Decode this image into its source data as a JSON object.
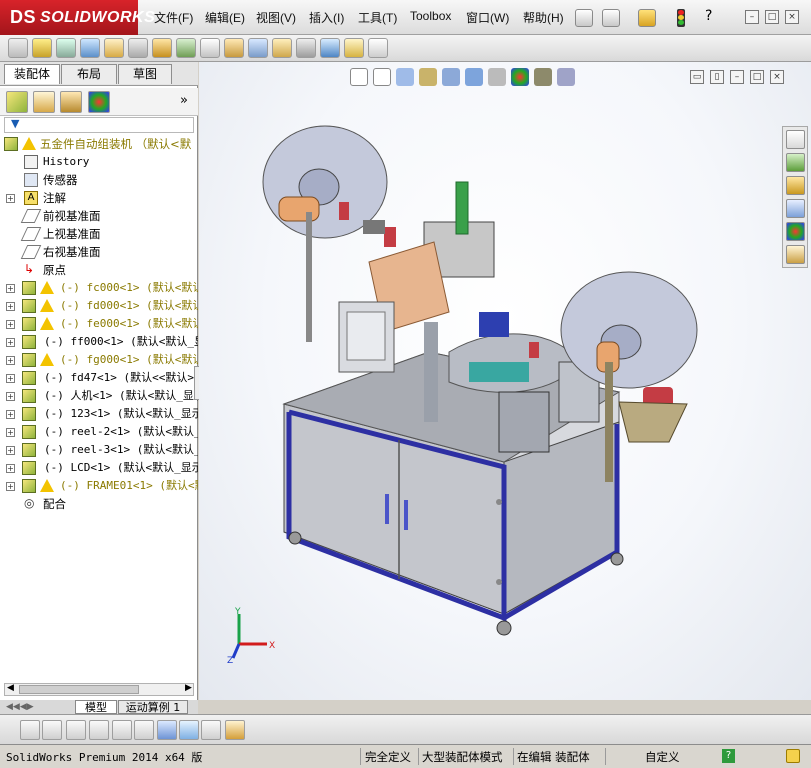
{
  "app": {
    "logo_text": "SOLIDWORKS",
    "logo_prefix": "DS"
  },
  "menu": {
    "items": [
      "文件(F)",
      "编辑(E)",
      "视图(V)",
      "插入(I)",
      "工具(T)",
      "Toolbox",
      "窗口(W)",
      "帮助(H)"
    ]
  },
  "tabs": {
    "items": [
      "装配体",
      "布局",
      "草图"
    ]
  },
  "tree": {
    "root": "五金件自动组装机 （默认<默",
    "items": [
      {
        "label": "History",
        "mono": true
      },
      {
        "label": "传感器"
      },
      {
        "label": "注解"
      },
      {
        "label": "前视基准面"
      },
      {
        "label": "上视基准面"
      },
      {
        "label": "右视基准面"
      },
      {
        "label": "原点"
      },
      {
        "label": "(-) fc000<1> (默认<默认",
        "warn": true
      },
      {
        "label": "(-) fd000<1> (默认<默认",
        "warn": true
      },
      {
        "label": "(-) fe000<1> (默认<默认",
        "warn": true
      },
      {
        "label": "(-) ff000<1> (默认<默认_显"
      },
      {
        "label": "(-) fg000<1> (默认<默认",
        "warn": true
      },
      {
        "label": "(-) fd47<1> (默认<<默认>_显"
      },
      {
        "label": "(-) 人机<1> (默认<默认_显示"
      },
      {
        "label": "(-) 123<1> (默认<默认_显示"
      },
      {
        "label": "(-) reel-2<1> (默认<默认_显"
      },
      {
        "label": "(-) reel-3<1> (默认<默认_显"
      },
      {
        "label": "(-) LCD<1> (默认<默认_显示"
      },
      {
        "label": "(-) FRAME01<1> (默认<默认",
        "warn": true
      },
      {
        "label": "配合"
      }
    ]
  },
  "bottom_tabs": {
    "model": "模型",
    "motion": "运动算例 1"
  },
  "status": {
    "product": "SolidWorks Premium 2014 x64 版",
    "fully_defined": "完全定义",
    "large_assembly": "大型装配体模式",
    "editing": "在编辑 装配体",
    "custom": "自定义",
    "help": "?"
  },
  "axes": {
    "x": "X",
    "y": "Y",
    "z": "Z"
  },
  "colors": {
    "accent": "#d8232a",
    "frame_blue": "#2d2fa3",
    "cabinet": "#c9cbd0"
  }
}
